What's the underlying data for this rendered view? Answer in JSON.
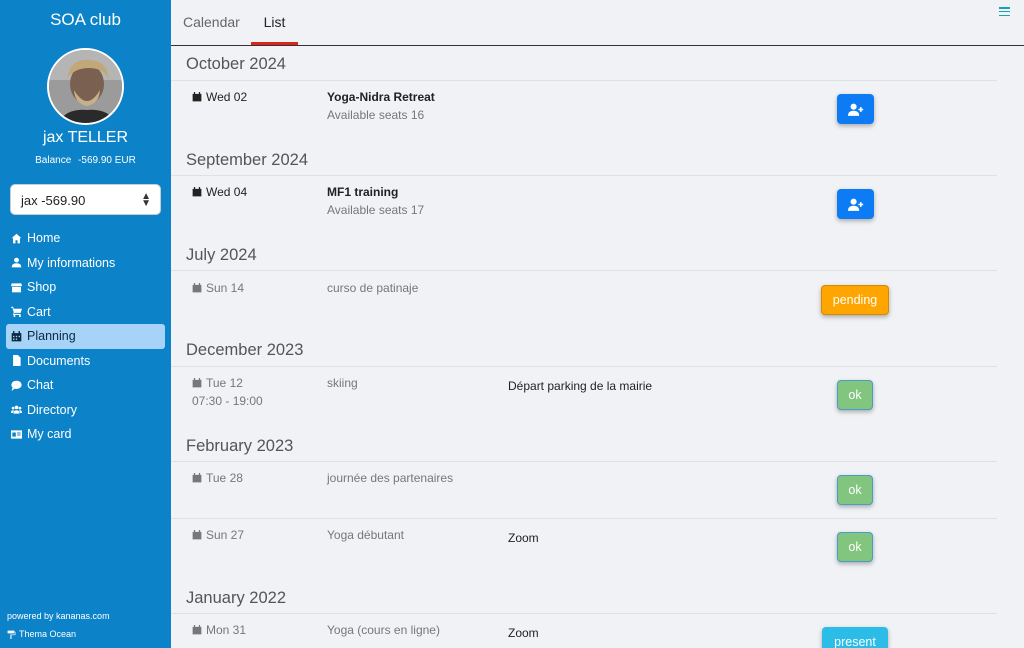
{
  "sidebar": {
    "club_name": "SOA club",
    "user_name": "jax TELLER",
    "balance_label": "Balance",
    "balance_value": "-569.90 EUR",
    "account_select": "jax -569.90",
    "nav": [
      {
        "label": "Home",
        "icon": "home-icon"
      },
      {
        "label": "My informations",
        "icon": "user-icon"
      },
      {
        "label": "Shop",
        "icon": "store-icon"
      },
      {
        "label": "Cart",
        "icon": "cart-icon"
      },
      {
        "label": "Planning",
        "icon": "calendar-icon",
        "active": true
      },
      {
        "label": "Documents",
        "icon": "file-icon"
      },
      {
        "label": "Chat",
        "icon": "chat-icon"
      },
      {
        "label": "Directory",
        "icon": "users-icon"
      },
      {
        "label": "My card",
        "icon": "id-card-icon"
      }
    ],
    "powered_by": "powered by kananas.com",
    "theme": "Thema Ocean",
    "colors": {
      "sidebar_bg": "#0c83c8",
      "active_item": "#a6d3f7"
    }
  },
  "tabs": {
    "calendar": "Calendar",
    "list": "List"
  },
  "groups": [
    {
      "month": "October 2024",
      "events": [
        {
          "date": "Wed 02",
          "title": "Yoga-Nidra Retreat",
          "subtitle": "Available seats 16",
          "action": "add-user"
        }
      ]
    },
    {
      "month": "September 2024",
      "events": [
        {
          "date": "Wed 04",
          "title": "MF1 training",
          "subtitle": "Available seats 17",
          "action": "add-user"
        }
      ]
    },
    {
      "month": "July 2024",
      "events": [
        {
          "date": "Sun 14",
          "title": "curso de patinaje",
          "status": "pending"
        }
      ]
    },
    {
      "month": "December 2023",
      "events": [
        {
          "date": "Tue 12",
          "time": "07:30 - 19:00",
          "title": "skiing",
          "info": "Départ parking de la mairie",
          "status": "ok"
        }
      ]
    },
    {
      "month": "February 2023",
      "events": [
        {
          "date": "Tue 28",
          "title": "journée des partenaires",
          "status": "ok"
        },
        {
          "date": "Sun 27",
          "title": "Yoga débutant",
          "info": "Zoom",
          "status": "ok"
        }
      ]
    },
    {
      "month": "January 2022",
      "events": [
        {
          "date": "Mon 31",
          "title": "Yoga (cours en ligne)",
          "info": "Zoom",
          "status": "present"
        }
      ]
    }
  ],
  "status_colors": {
    "pending": "#ffa500",
    "ok": "#82c57f",
    "present": "#2bbde8",
    "add": "#0d7cf4"
  }
}
